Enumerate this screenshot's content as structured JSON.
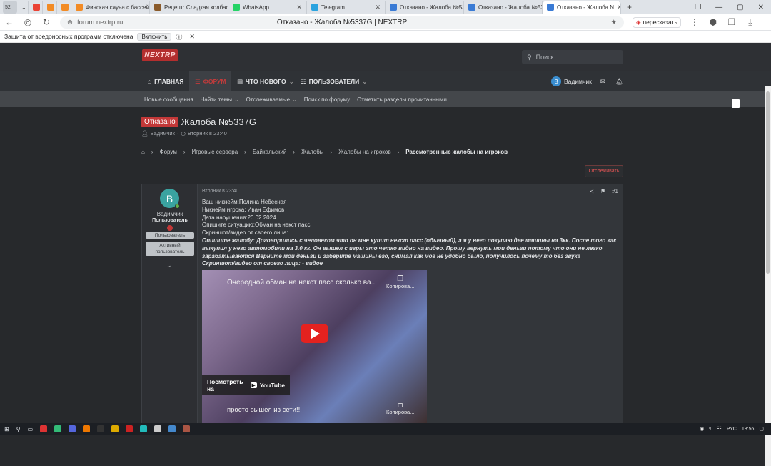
{
  "browser": {
    "tab_counter": "52",
    "tabs": [
      {
        "label": "",
        "color": "#ea4335"
      },
      {
        "label": "",
        "color": "#f28b25"
      },
      {
        "label": "",
        "color": "#f28b25"
      },
      {
        "label": "Финская сауна с бассейн",
        "color": "#f28b25"
      },
      {
        "label": "Рецепт: Сладкая колбас",
        "color": "#8a5b2b"
      },
      {
        "label": "WhatsApp",
        "color": "#25d366"
      },
      {
        "label": "Telegram",
        "color": "#2aa3df"
      },
      {
        "label": "Отказано - Жалоба №53",
        "color": "#3a7bd5"
      },
      {
        "label": "Отказано - Жалоба №53",
        "color": "#3a7bd5"
      },
      {
        "label": "Отказано - Жалоба N",
        "color": "#3a7bd5"
      }
    ],
    "url": "forum.nextrp.ru",
    "page_title": "Отказано - Жалоба №5337G | NEXTRP",
    "translate_label": "пересказать",
    "protection_text": "Защита от вредоносных программ отключена",
    "protection_button": "Включить"
  },
  "site": {
    "logo": "NEXTRP",
    "search_placeholder": "Поиск...",
    "nav": [
      {
        "label": "ГЛАВНАЯ"
      },
      {
        "label": "ФОРУМ"
      },
      {
        "label": "ЧТО НОВОГО"
      },
      {
        "label": "ПОЛЬЗОВАТЕЛИ"
      }
    ],
    "user": {
      "initial": "B",
      "name": "Вадимчик"
    },
    "subnav": [
      "Новые сообщения",
      "Найти темы",
      "Отслеживаемые",
      "Поиск по форуму",
      "Отметить разделы прочитанными"
    ]
  },
  "thread": {
    "status_badge": "Отказано",
    "title": "Жалоба №5337G",
    "author": "Вадимчик",
    "date": "Вторник в 23:40",
    "breadcrumbs": [
      "Форум",
      "Игровые сервера",
      "Байкальский",
      "Жалобы",
      "Жалобы на игроков",
      "Рассмотренные жалобы на игроков"
    ],
    "follow_button": "Отслеживать"
  },
  "post": {
    "author_initial": "B",
    "author_name": "Вадимчик",
    "author_role": "Пользователь",
    "tags": [
      "Пользователь",
      "Активный пользователь"
    ],
    "time": "Вторник в 23:40",
    "post_number": "#1",
    "lines": [
      "Ваш никнейм:Полина Небесная",
      "Никнейм игрока: Иван Ефимов",
      "Дата нарушения:20.02.2024",
      "Опишите ситуацию:Обман на некст пасс",
      "Скриншот/видео от своего лица:"
    ],
    "bold_lines": [
      "Опишите жалобу: Договорились с человеком что он мне купит некст пасс (обычный), а я у него покупаю две машины на 3кк. После того как выкупил у него автомобили на 3.0 кк. Он вышел с игры это четко видно на видео. Прошу вернуть мои деньги потому что они не легко зарабатываются Верните мои деньги и заберите машины его, снимал как мог не удобно было, получилось почему то без звука",
      "Скриншот/видео от своего лица: - видое"
    ],
    "video": {
      "title": "Очередной обман на некст пасс сколько ва...",
      "copy_label": "Копирова...",
      "watch_label": "Посмотреть на",
      "youtube_label": "YouTube",
      "subtitle": "просто вышел из сети!!!",
      "copy_label_2": "Копирова..."
    }
  },
  "taskbar": {
    "lang": "РУС",
    "time": "18:56"
  }
}
